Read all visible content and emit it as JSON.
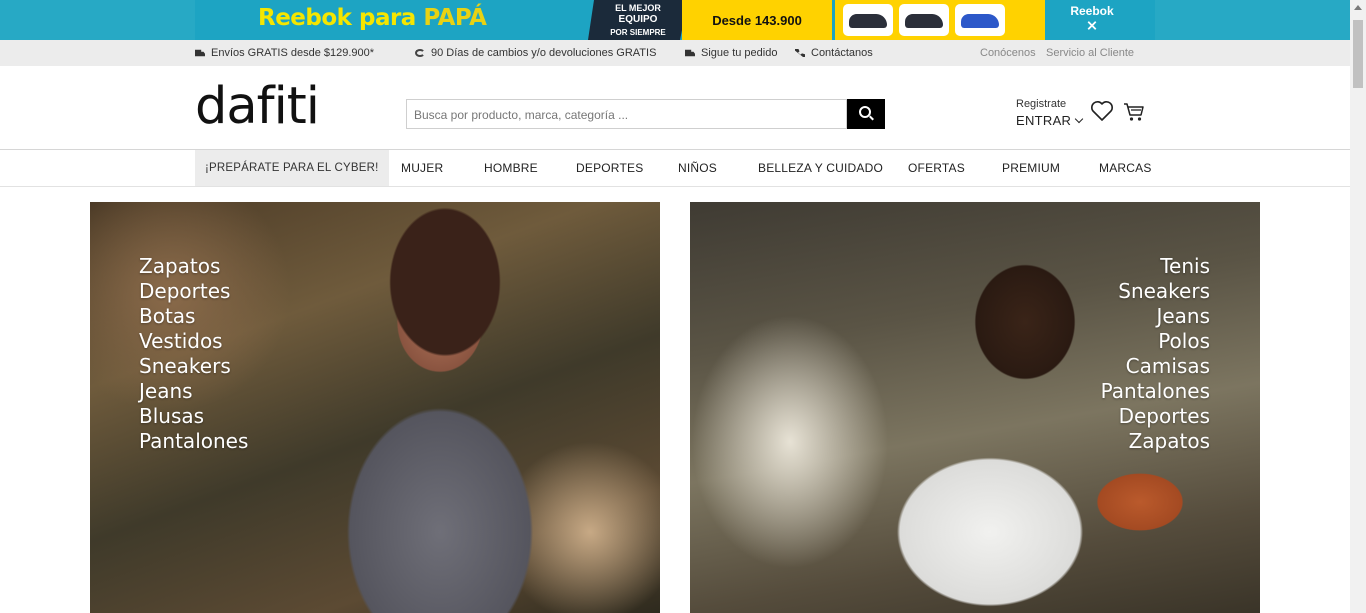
{
  "promo": {
    "title": "Reebok para ",
    "title_highlight": "PAPÁ",
    "badge_line1": "EL MEJOR",
    "badge_line2": "EQUIPO",
    "badge_line3": "POR SIEMPRE",
    "price": "Desde 143.900",
    "brand": "Reebok",
    "brand_mark": "⨯"
  },
  "infobar": {
    "shipping": "Envíos GRATIS desde $129.900*",
    "returns": "90 Días de cambios y/o devoluciones GRATIS",
    "track": "Sigue tu pedido",
    "contact": "Contáctanos",
    "about": "Conócenos",
    "service": "Servicio al Cliente"
  },
  "header": {
    "logo": "dafiti",
    "search_placeholder": "Busca por producto, marca, categoría ...",
    "account_register": "Registrate",
    "account_login": "ENTRAR"
  },
  "nav": {
    "promo": "¡PREPÁRATE PARA EL CYBER!",
    "items": [
      "MUJER",
      "HOMBRE",
      "DEPORTES",
      "NIÑOS",
      "BELLEZA Y CUIDADO",
      "OFERTAS",
      "PREMIUM",
      "MARCAS"
    ]
  },
  "hero_left": {
    "items": [
      "Zapatos",
      "Deportes",
      "Botas",
      "Vestidos",
      "Sneakers",
      "Jeans",
      "Blusas",
      "Pantalones"
    ]
  },
  "hero_right": {
    "items": [
      "Tenis",
      "Sneakers",
      "Jeans",
      "Polos",
      "Camisas",
      "Pantalones",
      "Deportes",
      "Zapatos"
    ]
  }
}
